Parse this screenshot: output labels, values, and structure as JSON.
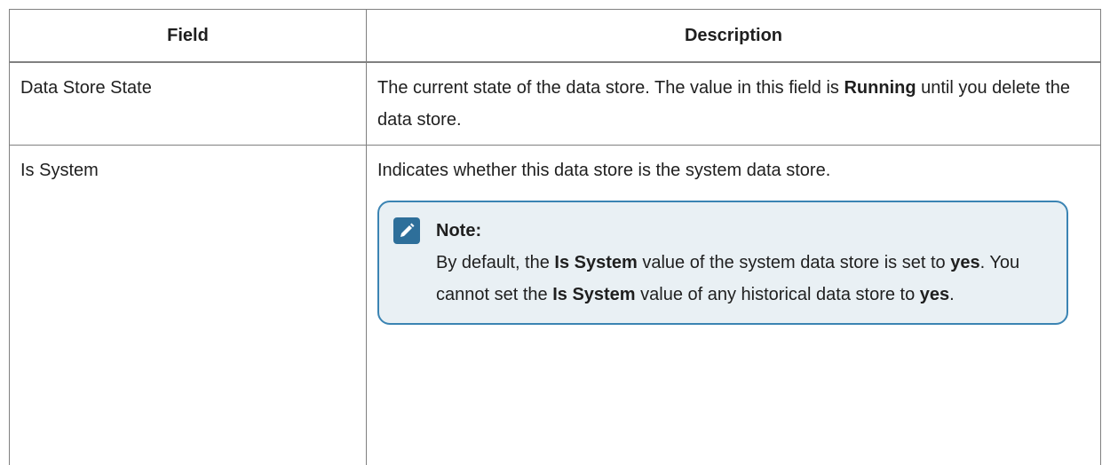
{
  "table": {
    "headers": {
      "field": "Field",
      "description": "Description"
    },
    "rows": [
      {
        "field": "Data Store State",
        "description": {
          "part1": "The current state of the data store. The value in this field is ",
          "bold1": "Running",
          "part2": " until you delete the data store."
        }
      },
      {
        "field": "Is System",
        "description": "Indicates whether this data store is the system data store."
      }
    ]
  },
  "note": {
    "icon": "pencil-note-icon",
    "title": "Note:",
    "text": {
      "t1": "By default, the ",
      "b1": "Is System",
      "t2": " value of the system data store is set to ",
      "b2": "yes",
      "t3": ". You cannot set the ",
      "b3": "Is System",
      "t4": " value of any historical data store to ",
      "b4": "yes",
      "t5": "."
    }
  },
  "colors": {
    "note_border": "#3b84b3",
    "note_background": "#e9f0f4",
    "icon_background": "#2e6f9a",
    "table_border": "#808080"
  }
}
